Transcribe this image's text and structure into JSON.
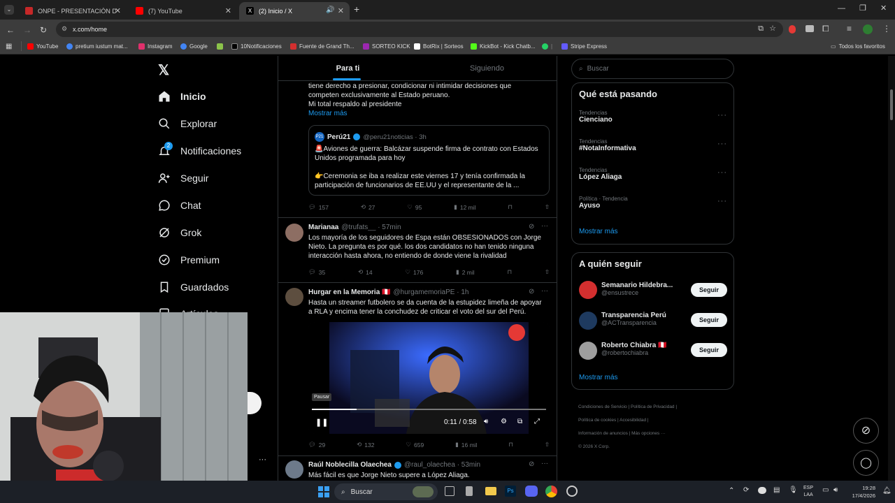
{
  "browser": {
    "tabs": [
      {
        "label": "ONPE - PRESENTACIÓN DE RES",
        "active": false
      },
      {
        "label": "(7) YouTube",
        "active": false
      },
      {
        "label": "(2) Inicio / X",
        "active": true
      }
    ],
    "new_tab": "+",
    "url": "x.com/home",
    "bookmarks": [
      {
        "label": "YouTube",
        "color": "#ff0000"
      },
      {
        "label": "pretium iustum mat...",
        "color": "#4285f4"
      },
      {
        "label": "Instagram",
        "color": "#e1306c"
      },
      {
        "label": "Google",
        "color": "#4285f4"
      },
      {
        "label": "",
        "color": "#8bc34a"
      },
      {
        "label": "10Notificaciones",
        "color": "#000000"
      },
      {
        "label": "Fuente de Grand Th...",
        "color": "#d32f2f"
      },
      {
        "label": "SORTEO KICK",
        "color": "#9c27b0"
      },
      {
        "label": "BotRix | Sorteos",
        "color": "#ffffff"
      },
      {
        "label": "KickBot - Kick Chatb...",
        "color": "#53fc18"
      },
      {
        "label": "",
        "color": "#25d366"
      },
      {
        "label": "Stripe Express",
        "color": "#635bff"
      }
    ],
    "all_bookmarks": "Todos los favoritos"
  },
  "sidebar": {
    "items": [
      {
        "label": "Inicio"
      },
      {
        "label": "Explorar"
      },
      {
        "label": "Notificaciones",
        "badge": "2"
      },
      {
        "label": "Seguir"
      },
      {
        "label": "Chat"
      },
      {
        "label": "Grok"
      },
      {
        "label": "Premium"
      },
      {
        "label": "Guardados"
      },
      {
        "label": "Artículos"
      }
    ],
    "more_dots": "···"
  },
  "feed": {
    "tabs": [
      "Para ti",
      "Siguiendo"
    ],
    "tweet1": {
      "text_lines": [
        "tiene derecho a presionar, condicionar ni intimidar decisiones que",
        "competen exclusivamente al Estado peruano.",
        "Mi total respaldo al presidente"
      ],
      "show_more": "Mostrar más",
      "quote": {
        "avatar_text": "P21",
        "name": "Perú21",
        "handle": "@peru21noticias · 3h",
        "line1": "🚨Aviones de guerra: Balcázar suspende firma de contrato con Estados",
        "line2": "Unidos programada para hoy",
        "line3": "👉Ceremonia se iba a realizar este viernes 17 y tenía confirmada la",
        "line4": "participación de funcionarios de EE.UU y el representante de la ..."
      },
      "stats": {
        "replies": "157",
        "reposts": "27",
        "likes": "95",
        "views": "12 mil"
      }
    },
    "tweet2": {
      "name": "Marianaa",
      "handle": "@trufats__ · 57min",
      "text_lines": [
        "Los mayoría de los seguidores de Espa están OBSESIONADOS con Jorge",
        "Nieto. La pregunta es por qué. los dos candidatos no han tenido ninguna",
        "interacción hasta ahora, no entiendo de donde viene la rivalidad"
      ],
      "stats": {
        "replies": "35",
        "reposts": "14",
        "likes": "176",
        "views": "2 mil"
      }
    },
    "tweet3": {
      "name": "Hurgar en la Memoria 🇵🇪",
      "handle": "@hurgamemoriaPE · 1h",
      "text_lines": [
        "Hasta un streamer futbolero se da cuenta de la estupidez limeña de apoyar",
        "a RLA y encima tener la conchudez de criticar el voto del sur del Perú."
      ],
      "video": {
        "tooltip": "Pausar",
        "time": "0:11 / 0:58",
        "progress": 0.19
      },
      "stats": {
        "replies": "29",
        "reposts": "132",
        "likes": "659",
        "views": "16 mil"
      }
    },
    "tweet4": {
      "name": "Raúl Noblecilla Olaechea",
      "handle": "@raul_olaechea · 53min",
      "text": "Más fácil es que Jorge Nieto supere a López Aliaga."
    }
  },
  "right": {
    "search_placeholder": "Buscar",
    "trends_title": "Qué está pasando",
    "trends": [
      {
        "sub": "Tendencias",
        "title": "Cienciano"
      },
      {
        "sub": "Tendencias",
        "title": "#NotaInformativa"
      },
      {
        "sub": "Tendencias",
        "title": "López Aliaga"
      },
      {
        "sub": "Política · Tendencia",
        "title": "Ayuso"
      }
    ],
    "show_more": "Mostrar más",
    "follow_title": "A quién seguir",
    "follow": [
      {
        "name": "Semanario Hildebra...",
        "handle": "@ensustrece",
        "btn": "Seguir",
        "color": "#d32f2f"
      },
      {
        "name": "Transparencia Perú",
        "handle": "@ACTransparencia",
        "btn": "Seguir",
        "color": "#1e3a5f"
      },
      {
        "name": "Roberto Chiabra 🇵🇪",
        "handle": "@robertochiabra",
        "btn": "Seguir",
        "color": "#9e9e9e"
      }
    ],
    "follow_more": "Mostrar más",
    "footer": [
      "Condiciones de Servicio",
      "Política de Privacidad",
      "Política de cookies",
      "Accesibilidad",
      "Información de anuncios",
      "Más opciones ···",
      "© 2026 X Corp."
    ]
  },
  "taskbar": {
    "search": "Buscar",
    "lang": "ESP",
    "lang2": "LAA",
    "time": "19:28",
    "date": "17/4/2026"
  }
}
